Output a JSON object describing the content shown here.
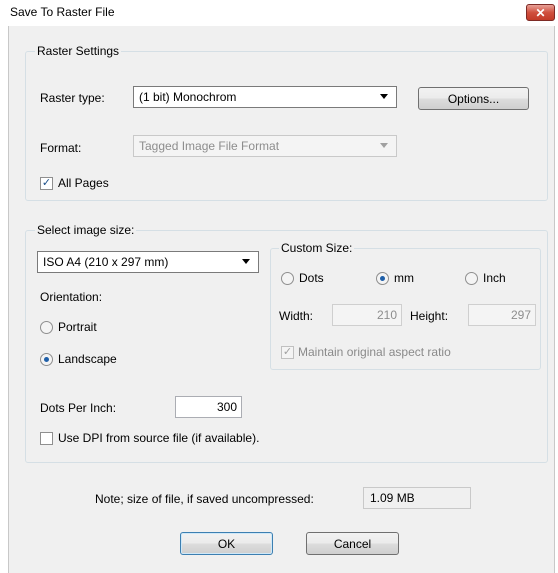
{
  "window": {
    "title": "Save To Raster File",
    "close_glyph": "✕"
  },
  "raster_settings": {
    "legend": "Raster Settings",
    "raster_type_label": "Raster type:",
    "raster_type_value": "(1 bit) Monochrom",
    "options_button": "Options...",
    "format_label": "Format:",
    "format_value": "Tagged Image File Format",
    "all_pages_label": "All Pages",
    "all_pages_checked": true
  },
  "image_size": {
    "legend": "Select image size:",
    "size_value": "ISO A4  (210 x 297 mm)",
    "orientation_label": "Orientation:",
    "portrait_label": "Portrait",
    "landscape_label": "Landscape",
    "orientation_selected": "Landscape",
    "custom_size": {
      "legend": "Custom Size:",
      "unit_dots": "Dots",
      "unit_mm": "mm",
      "unit_inch": "Inch",
      "unit_selected": "mm",
      "width_label": "Width:",
      "width_value": "210",
      "height_label": "Height:",
      "height_value": "297",
      "maintain_label": "Maintain original aspect ratio",
      "maintain_checked": true
    },
    "dpi_label": "Dots Per Inch:",
    "dpi_value": "300",
    "use_dpi_label": "Use DPI from source file (if available).",
    "use_dpi_checked": false
  },
  "footer": {
    "note_label": "Note; size of file, if saved uncompressed:",
    "note_value": "1.09 MB",
    "ok_button": "OK",
    "cancel_button": "Cancel"
  },
  "check_glyph": "✓"
}
